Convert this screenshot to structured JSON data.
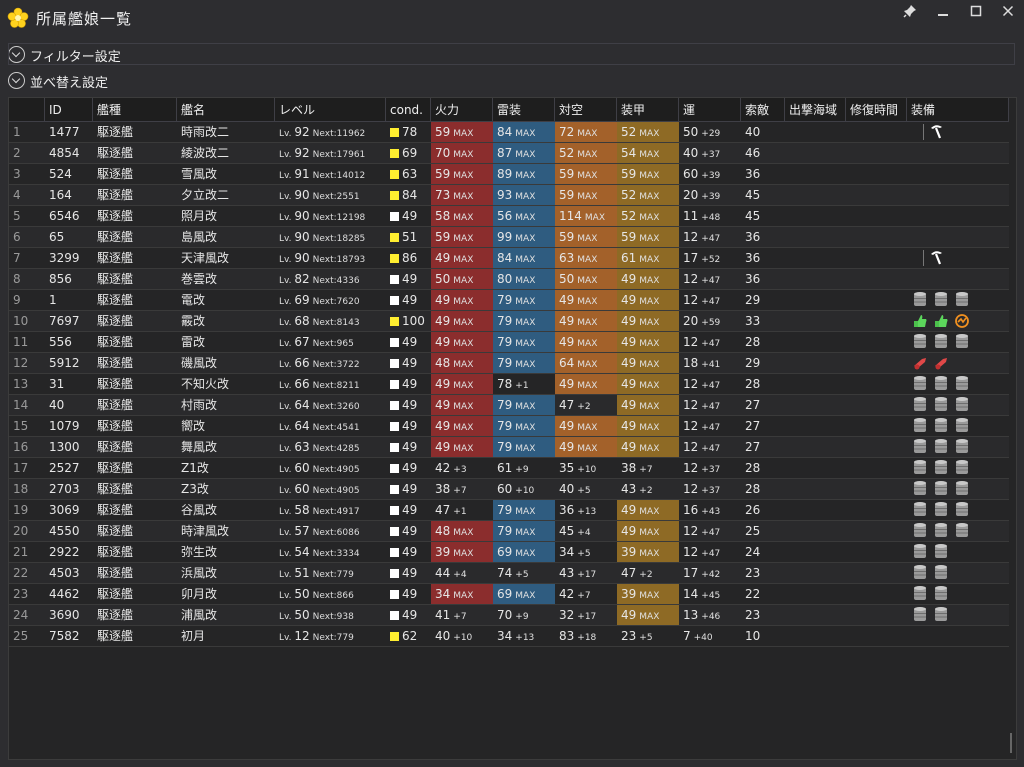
{
  "window": {
    "title": "所属艦娘一覧",
    "buttons": [
      "pin-icon",
      "minimize-icon",
      "maximize-icon",
      "close-icon"
    ]
  },
  "expanders": [
    {
      "label": "フィルター設定"
    },
    {
      "label": "並べ替え設定"
    }
  ],
  "columns": [
    "",
    "ID",
    "艦種",
    "艦名",
    "レベル",
    "cond.",
    "火力",
    "雷装",
    "対空",
    "装甲",
    "運",
    "索敵",
    "出撃海域",
    "修復時間",
    "装備"
  ],
  "colors": {
    "fire_max": "#8b2d2d",
    "torpedo_max": "#2f5c80",
    "aa_max": "#a3612a",
    "armor_max": "#8e6a25",
    "cond_high": "#ffee30",
    "cond_normal": "#ffffff"
  },
  "rows": [
    {
      "no": "1",
      "id": "1477",
      "type": "駆逐艦",
      "name": "時雨改二",
      "lv": "92",
      "next": "Next:11962",
      "cond": "78",
      "condHigh": true,
      "fire": [
        "59",
        "MAX"
      ],
      "torp": [
        "84",
        "MAX"
      ],
      "aa": [
        "72",
        "MAX"
      ],
      "armor": [
        "52",
        "MAX"
      ],
      "luck": [
        "50",
        "+29"
      ],
      "los": "40",
      "equip": [
        "pickaxe-icon"
      ]
    },
    {
      "no": "2",
      "id": "4854",
      "type": "駆逐艦",
      "name": "綾波改二",
      "lv": "92",
      "next": "Next:17961",
      "cond": "69",
      "condHigh": true,
      "fire": [
        "70",
        "MAX"
      ],
      "torp": [
        "87",
        "MAX"
      ],
      "aa": [
        "52",
        "MAX"
      ],
      "armor": [
        "54",
        "MAX"
      ],
      "luck": [
        "40",
        "+37"
      ],
      "los": "46",
      "equip": []
    },
    {
      "no": "3",
      "id": "524",
      "type": "駆逐艦",
      "name": "雪風改",
      "lv": "91",
      "next": "Next:14012",
      "cond": "63",
      "condHigh": true,
      "fire": [
        "59",
        "MAX"
      ],
      "torp": [
        "89",
        "MAX"
      ],
      "aa": [
        "59",
        "MAX"
      ],
      "armor": [
        "59",
        "MAX"
      ],
      "luck": [
        "60",
        "+39"
      ],
      "los": "36",
      "equip": []
    },
    {
      "no": "4",
      "id": "164",
      "type": "駆逐艦",
      "name": "夕立改二",
      "lv": "90",
      "next": "Next:2551",
      "cond": "84",
      "condHigh": true,
      "fire": [
        "73",
        "MAX"
      ],
      "torp": [
        "93",
        "MAX"
      ],
      "aa": [
        "59",
        "MAX"
      ],
      "armor": [
        "52",
        "MAX"
      ],
      "luck": [
        "20",
        "+39"
      ],
      "los": "45",
      "equip": []
    },
    {
      "no": "5",
      "id": "6546",
      "type": "駆逐艦",
      "name": "照月改",
      "lv": "90",
      "next": "Next:12198",
      "cond": "49",
      "condHigh": false,
      "fire": [
        "58",
        "MAX"
      ],
      "torp": [
        "56",
        "MAX"
      ],
      "aa": [
        "114",
        "MAX"
      ],
      "armor": [
        "52",
        "MAX"
      ],
      "luck": [
        "11",
        "+48"
      ],
      "los": "45",
      "equip": []
    },
    {
      "no": "6",
      "id": "65",
      "type": "駆逐艦",
      "name": "島風改",
      "lv": "90",
      "next": "Next:18285",
      "cond": "51",
      "condHigh": true,
      "fire": [
        "59",
        "MAX"
      ],
      "torp": [
        "99",
        "MAX"
      ],
      "aa": [
        "59",
        "MAX"
      ],
      "armor": [
        "59",
        "MAX"
      ],
      "luck": [
        "12",
        "+47"
      ],
      "los": "36",
      "equip": []
    },
    {
      "no": "7",
      "id": "3299",
      "type": "駆逐艦",
      "name": "天津風改",
      "lv": "90",
      "next": "Next:18793",
      "cond": "86",
      "condHigh": true,
      "fire": [
        "49",
        "MAX"
      ],
      "torp": [
        "84",
        "MAX"
      ],
      "aa": [
        "63",
        "MAX"
      ],
      "armor": [
        "61",
        "MAX"
      ],
      "luck": [
        "17",
        "+52"
      ],
      "los": "36",
      "equip": [
        "pickaxe-icon"
      ]
    },
    {
      "no": "8",
      "id": "856",
      "type": "駆逐艦",
      "name": "巻雲改",
      "lv": "82",
      "next": "Next:4336",
      "cond": "49",
      "condHigh": false,
      "fire": [
        "50",
        "MAX"
      ],
      "torp": [
        "80",
        "MAX"
      ],
      "aa": [
        "50",
        "MAX"
      ],
      "armor": [
        "49",
        "MAX"
      ],
      "luck": [
        "12",
        "+47"
      ],
      "los": "36",
      "equip": []
    },
    {
      "no": "9",
      "id": "1",
      "type": "駆逐艦",
      "name": "電改",
      "lv": "69",
      "next": "Next:7620",
      "cond": "49",
      "condHigh": false,
      "fire": [
        "49",
        "MAX"
      ],
      "torp": [
        "79",
        "MAX"
      ],
      "aa": [
        "49",
        "MAX"
      ],
      "armor": [
        "49",
        "MAX"
      ],
      "luck": [
        "12",
        "+47"
      ],
      "los": "29",
      "equip": [
        "drum-icon",
        "drum-icon",
        "drum-icon"
      ]
    },
    {
      "no": "10",
      "id": "7697",
      "type": "駆逐艦",
      "name": "霰改",
      "lv": "68",
      "next": "Next:8143",
      "cond": "100",
      "condHigh": true,
      "fire": [
        "49",
        "MAX"
      ],
      "torp": [
        "79",
        "MAX"
      ],
      "aa": [
        "49",
        "MAX"
      ],
      "armor": [
        "49",
        "MAX"
      ],
      "luck": [
        "20",
        "+59"
      ],
      "los": "33",
      "equip": [
        "green-hand-icon",
        "green-hand-icon",
        "radar-icon"
      ]
    },
    {
      "no": "11",
      "id": "556",
      "type": "駆逐艦",
      "name": "雷改",
      "lv": "67",
      "next": "Next:965",
      "cond": "49",
      "condHigh": false,
      "fire": [
        "49",
        "MAX"
      ],
      "torp": [
        "79",
        "MAX"
      ],
      "aa": [
        "49",
        "MAX"
      ],
      "armor": [
        "49",
        "MAX"
      ],
      "luck": [
        "12",
        "+47"
      ],
      "los": "28",
      "equip": [
        "drum-icon",
        "drum-icon",
        "drum-icon"
      ]
    },
    {
      "no": "12",
      "id": "5912",
      "type": "駆逐艦",
      "name": "磯風改",
      "lv": "66",
      "next": "Next:3722",
      "cond": "49",
      "condHigh": false,
      "fire": [
        "48",
        "MAX"
      ],
      "torp": [
        "79",
        "MAX"
      ],
      "aa": [
        "64",
        "MAX"
      ],
      "armor": [
        "49",
        "MAX"
      ],
      "luck": [
        "18",
        "+41"
      ],
      "los": "29",
      "equip": [
        "red-gun-icon",
        "red-gun-icon"
      ]
    },
    {
      "no": "13",
      "id": "31",
      "type": "駆逐艦",
      "name": "不知火改",
      "lv": "66",
      "next": "Next:8211",
      "cond": "49",
      "condHigh": false,
      "fire": [
        "49",
        "MAX"
      ],
      "torp": [
        "78",
        "+1"
      ],
      "aa": [
        "49",
        "MAX"
      ],
      "armor": [
        "49",
        "MAX"
      ],
      "luck": [
        "12",
        "+47"
      ],
      "los": "28",
      "equip": [
        "drum-icon",
        "drum-icon",
        "drum-icon"
      ]
    },
    {
      "no": "14",
      "id": "40",
      "type": "駆逐艦",
      "name": "村雨改",
      "lv": "64",
      "next": "Next:3260",
      "cond": "49",
      "condHigh": false,
      "fire": [
        "49",
        "MAX"
      ],
      "torp": [
        "79",
        "MAX"
      ],
      "aa": [
        "47",
        "+2"
      ],
      "armor": [
        "49",
        "MAX"
      ],
      "luck": [
        "12",
        "+47"
      ],
      "los": "27",
      "equip": [
        "drum-icon",
        "drum-icon",
        "drum-icon"
      ]
    },
    {
      "no": "15",
      "id": "1079",
      "type": "駆逐艦",
      "name": "嚮改",
      "lv": "64",
      "next": "Next:4541",
      "cond": "49",
      "condHigh": false,
      "fire": [
        "49",
        "MAX"
      ],
      "torp": [
        "79",
        "MAX"
      ],
      "aa": [
        "49",
        "MAX"
      ],
      "armor": [
        "49",
        "MAX"
      ],
      "luck": [
        "12",
        "+47"
      ],
      "los": "27",
      "equip": [
        "drum-icon",
        "drum-icon",
        "drum-icon"
      ]
    },
    {
      "no": "16",
      "id": "1300",
      "type": "駆逐艦",
      "name": "舞風改",
      "lv": "63",
      "next": "Next:4285",
      "cond": "49",
      "condHigh": false,
      "fire": [
        "49",
        "MAX"
      ],
      "torp": [
        "79",
        "MAX"
      ],
      "aa": [
        "49",
        "MAX"
      ],
      "armor": [
        "49",
        "MAX"
      ],
      "luck": [
        "12",
        "+47"
      ],
      "los": "27",
      "equip": [
        "drum-icon",
        "drum-icon",
        "drum-icon"
      ]
    },
    {
      "no": "17",
      "id": "2527",
      "type": "駆逐艦",
      "name": "Z1改",
      "lv": "60",
      "next": "Next:4905",
      "cond": "49",
      "condHigh": false,
      "fire": [
        "42",
        "+3"
      ],
      "torp": [
        "61",
        "+9"
      ],
      "aa": [
        "35",
        "+10"
      ],
      "armor": [
        "38",
        "+7"
      ],
      "luck": [
        "12",
        "+37"
      ],
      "los": "28",
      "equip": [
        "drum-icon",
        "drum-icon",
        "drum-icon"
      ]
    },
    {
      "no": "18",
      "id": "2703",
      "type": "駆逐艦",
      "name": "Z3改",
      "lv": "60",
      "next": "Next:4905",
      "cond": "49",
      "condHigh": false,
      "fire": [
        "38",
        "+7"
      ],
      "torp": [
        "60",
        "+10"
      ],
      "aa": [
        "40",
        "+5"
      ],
      "armor": [
        "43",
        "+2"
      ],
      "luck": [
        "12",
        "+37"
      ],
      "los": "28",
      "equip": [
        "drum-icon",
        "drum-icon",
        "drum-icon"
      ]
    },
    {
      "no": "19",
      "id": "3069",
      "type": "駆逐艦",
      "name": "谷風改",
      "lv": "58",
      "next": "Next:4917",
      "cond": "49",
      "condHigh": false,
      "fire": [
        "47",
        "+1"
      ],
      "torp": [
        "79",
        "MAX"
      ],
      "aa": [
        "36",
        "+13"
      ],
      "armor": [
        "49",
        "MAX"
      ],
      "luck": [
        "16",
        "+43"
      ],
      "los": "26",
      "equip": [
        "drum-icon",
        "drum-icon",
        "drum-icon"
      ]
    },
    {
      "no": "20",
      "id": "4550",
      "type": "駆逐艦",
      "name": "時津風改",
      "lv": "57",
      "next": "Next:6086",
      "cond": "49",
      "condHigh": false,
      "fire": [
        "48",
        "MAX"
      ],
      "torp": [
        "79",
        "MAX"
      ],
      "aa": [
        "45",
        "+4"
      ],
      "armor": [
        "49",
        "MAX"
      ],
      "luck": [
        "12",
        "+47"
      ],
      "los": "25",
      "equip": [
        "drum-icon",
        "drum-icon",
        "drum-icon"
      ]
    },
    {
      "no": "21",
      "id": "2922",
      "type": "駆逐艦",
      "name": "弥生改",
      "lv": "54",
      "next": "Next:3334",
      "cond": "49",
      "condHigh": false,
      "fire": [
        "39",
        "MAX"
      ],
      "torp": [
        "69",
        "MAX"
      ],
      "aa": [
        "34",
        "+5"
      ],
      "armor": [
        "39",
        "MAX"
      ],
      "luck": [
        "12",
        "+47"
      ],
      "los": "24",
      "equip": [
        "drum-icon",
        "drum-icon"
      ]
    },
    {
      "no": "22",
      "id": "4503",
      "type": "駆逐艦",
      "name": "浜風改",
      "lv": "51",
      "next": "Next:779",
      "cond": "49",
      "condHigh": false,
      "fire": [
        "44",
        "+4"
      ],
      "torp": [
        "74",
        "+5"
      ],
      "aa": [
        "43",
        "+17"
      ],
      "armor": [
        "47",
        "+2"
      ],
      "luck": [
        "17",
        "+42"
      ],
      "los": "23",
      "equip": [
        "drum-icon",
        "drum-icon"
      ]
    },
    {
      "no": "23",
      "id": "4462",
      "type": "駆逐艦",
      "name": "卯月改",
      "lv": "50",
      "next": "Next:866",
      "cond": "49",
      "condHigh": false,
      "fire": [
        "34",
        "MAX"
      ],
      "torp": [
        "69",
        "MAX"
      ],
      "aa": [
        "42",
        "+7"
      ],
      "armor": [
        "39",
        "MAX"
      ],
      "luck": [
        "14",
        "+45"
      ],
      "los": "22",
      "equip": [
        "drum-icon",
        "drum-icon"
      ]
    },
    {
      "no": "24",
      "id": "3690",
      "type": "駆逐艦",
      "name": "浦風改",
      "lv": "50",
      "next": "Next:938",
      "cond": "49",
      "condHigh": false,
      "fire": [
        "41",
        "+7"
      ],
      "torp": [
        "70",
        "+9"
      ],
      "aa": [
        "32",
        "+17"
      ],
      "armor": [
        "49",
        "MAX"
      ],
      "luck": [
        "13",
        "+46"
      ],
      "los": "23",
      "equip": [
        "drum-icon",
        "drum-icon"
      ]
    },
    {
      "no": "25",
      "id": "7582",
      "type": "駆逐艦",
      "name": "初月",
      "lv": "12",
      "next": "Next:779",
      "cond": "62",
      "condHigh": true,
      "fire": [
        "40",
        "+10"
      ],
      "torp": [
        "34",
        "+13"
      ],
      "aa": [
        "83",
        "+18"
      ],
      "armor": [
        "23",
        "+5"
      ],
      "luck": [
        "7",
        "+40"
      ],
      "los": "10",
      "equip": []
    }
  ]
}
